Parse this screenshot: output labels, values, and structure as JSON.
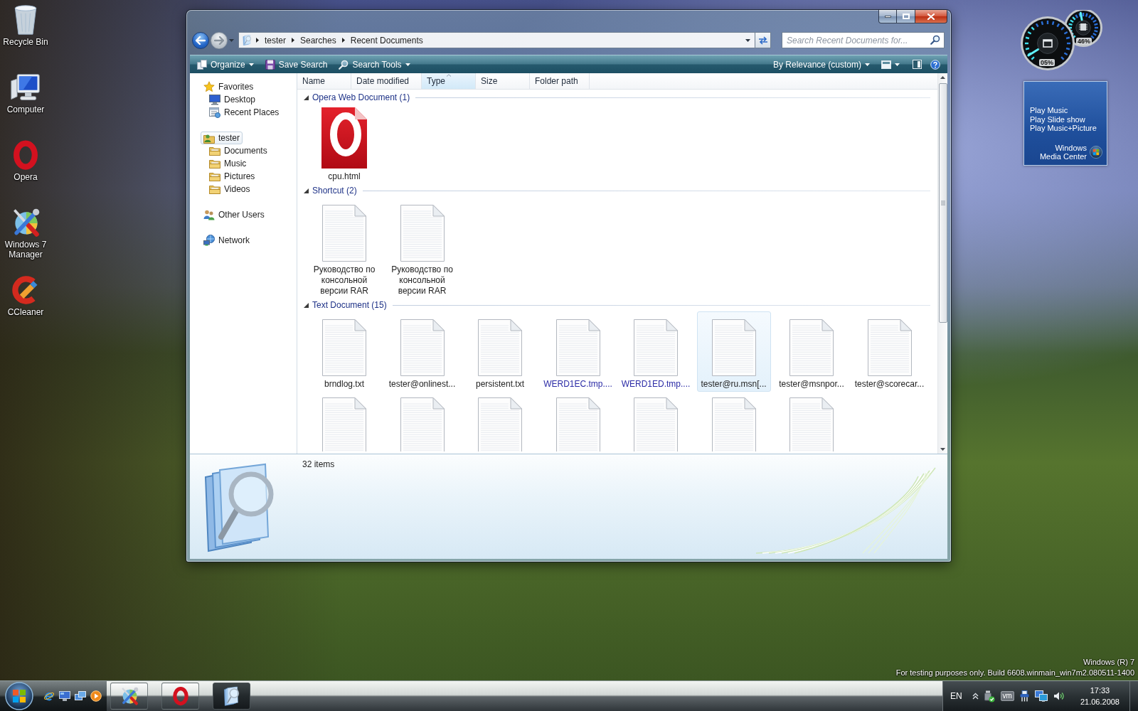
{
  "desktop_icons": [
    {
      "label": "Recycle Bin"
    },
    {
      "label": "Computer"
    },
    {
      "label": "Opera"
    },
    {
      "label": "Windows 7 Manager"
    },
    {
      "label": "CCleaner"
    }
  ],
  "window": {
    "navigation": {
      "back": {
        "disabled": false
      },
      "forward": {
        "disabled": true
      }
    },
    "breadcrumbs": [
      "tester",
      "Searches",
      "Recent Documents"
    ],
    "search": {
      "placeholder": "Search Recent Documents for..."
    },
    "toolbar": {
      "buttons": [
        {
          "label": "Organize",
          "dropdown": true
        },
        {
          "label": "Save Search",
          "dropdown": false
        },
        {
          "label": "Search Tools",
          "dropdown": true
        }
      ],
      "arrange": {
        "label": "By Relevance (custom)",
        "dropdown": true
      }
    },
    "sidebar": {
      "items": [
        {
          "label": "Favorites",
          "selected": false,
          "children": [
            {
              "label": "Desktop",
              "selected": false
            },
            {
              "label": "Recent Places",
              "selected": false
            }
          ]
        },
        {
          "label": "tester",
          "selected": true,
          "children": [
            {
              "label": "Documents",
              "selected": false
            },
            {
              "label": "Music",
              "selected": false
            },
            {
              "label": "Pictures",
              "selected": false
            },
            {
              "label": "Videos",
              "selected": false
            }
          ]
        },
        {
          "label": "Other Users",
          "selected": false
        },
        {
          "label": "Network",
          "selected": false
        }
      ]
    },
    "columns": [
      {
        "label": "Name",
        "sorted": false
      },
      {
        "label": "Date modified",
        "sorted": false
      },
      {
        "label": "Type",
        "sorted": true
      },
      {
        "label": "Size",
        "sorted": false
      },
      {
        "label": "Folder path",
        "sorted": false
      }
    ],
    "groups": [
      {
        "title": "Opera Web Document (1)",
        "expanded": true,
        "items": [
          {
            "name": "cpu.html",
            "kind": "web_page",
            "selected": false,
            "color": "#1e1e1e"
          }
        ]
      },
      {
        "title": "Shortcut (2)",
        "expanded": true,
        "items": [
          {
            "name": "Руководство по консольной версии RAR",
            "kind": "text",
            "selected": false,
            "color": "#1e1e1e"
          },
          {
            "name": "Руководство по консольной версии RAR",
            "kind": "text",
            "selected": false,
            "color": "#1e1e1e"
          }
        ]
      },
      {
        "title": "Text Document (15)",
        "expanded": true,
        "items": [
          {
            "name": "brndlog.txt",
            "kind": "text",
            "selected": false,
            "color": "#1e1e1e"
          },
          {
            "name": "tester@onlinest...",
            "kind": "text",
            "selected": false,
            "color": "#1e1e1e"
          },
          {
            "name": "persistent.txt",
            "kind": "text",
            "selected": false,
            "color": "#1e1e1e"
          },
          {
            "name": "WERD1EC.tmp....",
            "kind": "text",
            "selected": false,
            "color": "#2b2ba6"
          },
          {
            "name": "WERD1ED.tmp....",
            "kind": "text",
            "selected": false,
            "color": "#2b2ba6"
          },
          {
            "name": "tester@ru.msn[...",
            "kind": "text",
            "selected": true,
            "color": "#1e1e1e"
          },
          {
            "name": "tester@msnpor...",
            "kind": "text",
            "selected": false,
            "color": "#1e1e1e"
          },
          {
            "name": "tester@scorecar...",
            "kind": "text",
            "selected": false,
            "color": "#1e1e1e"
          },
          {
            "kind": "text",
            "selected": false
          },
          {
            "kind": "text",
            "selected": false
          },
          {
            "kind": "text",
            "selected": false
          },
          {
            "kind": "text",
            "selected": false
          },
          {
            "kind": "text",
            "selected": false
          },
          {
            "kind": "text",
            "selected": false
          },
          {
            "kind": "text",
            "selected": false
          }
        ]
      }
    ],
    "details": {
      "summary": "32 items"
    }
  },
  "gadgets": {
    "cpu_meter": [
      {
        "reading": "05%"
      },
      {
        "reading": "46%"
      }
    ],
    "media_center": {
      "links": [
        "Play Music",
        "Play Slide show",
        "Play Music+Picture"
      ],
      "label": "Windows Media Center"
    }
  },
  "build_info": {
    "product": "Windows (R) 7",
    "notice": "For testing purposes only. Build 6608.winmain_win7m2.080511-1400"
  },
  "taskbar": {
    "buttons": [
      {
        "selected": false
      },
      {
        "selected": false
      },
      {
        "selected": true
      }
    ],
    "tray": {
      "language": "EN",
      "badge": "vm",
      "time": "17:33",
      "date": "21.06.2008"
    }
  }
}
